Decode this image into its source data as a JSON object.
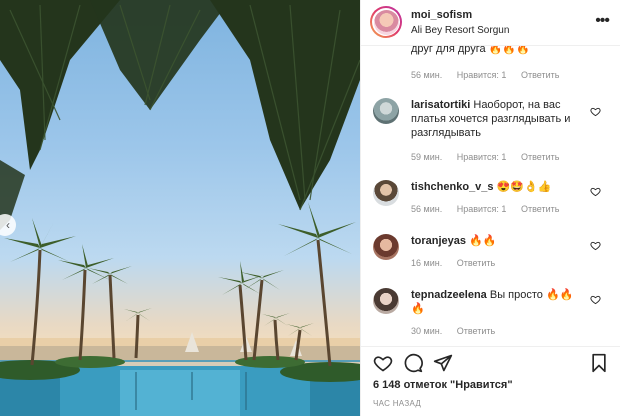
{
  "header": {
    "username": "moi_sofism",
    "location": "Ali Bey Resort Sorgun",
    "more_icon": "more-horizontal-icon"
  },
  "comments": [
    {
      "text": "друг для друга 🔥🔥🔥",
      "time": "56 мин.",
      "likes": "Нравится: 1",
      "reply": "Ответить"
    },
    {
      "username": "larisatortiki",
      "text": "Наоборот, на вас платья хочется разглядывать и разглядывать",
      "time": "59 мин.",
      "likes": "Нравится: 1",
      "reply": "Ответить"
    },
    {
      "username": "tishchenko_v_s",
      "text": "😍🤩👌👍",
      "time": "56 мин.",
      "likes": "Нравится: 1",
      "reply": "Ответить"
    },
    {
      "username": "toranjeyas",
      "text": "🔥🔥",
      "time": "16 мин.",
      "reply": "Ответить"
    },
    {
      "username": "tepnadzeelena",
      "text": "Вы просто 🔥🔥🔥",
      "time": "30 мин.",
      "reply": "Ответить"
    }
  ],
  "actions": {
    "likes_count": "6 148 отметок \"Нравится\"",
    "posted_time": "ЧАС НАЗАД"
  },
  "colors": {
    "text": "#262626",
    "muted": "#8e8e8e",
    "border": "#efefef"
  }
}
